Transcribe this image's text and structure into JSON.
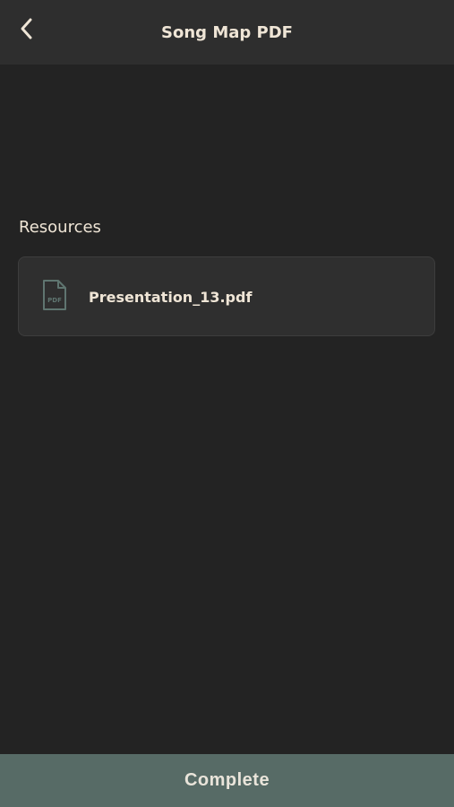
{
  "header": {
    "title": "Song Map PDF",
    "back_icon": "chevron-left-icon"
  },
  "resources": {
    "label": "Resources",
    "files": [
      {
        "name": "Presentation_13.pdf",
        "icon": "pdf-file-icon",
        "icon_text": "PDF"
      }
    ]
  },
  "footer": {
    "complete_label": "Complete"
  },
  "colors": {
    "background": "#232323",
    "header_background": "#2e2e2e",
    "card_background": "#2f2f2f",
    "text": "#efe5d6",
    "accent": "#576b66",
    "icon": "#5f7570"
  }
}
